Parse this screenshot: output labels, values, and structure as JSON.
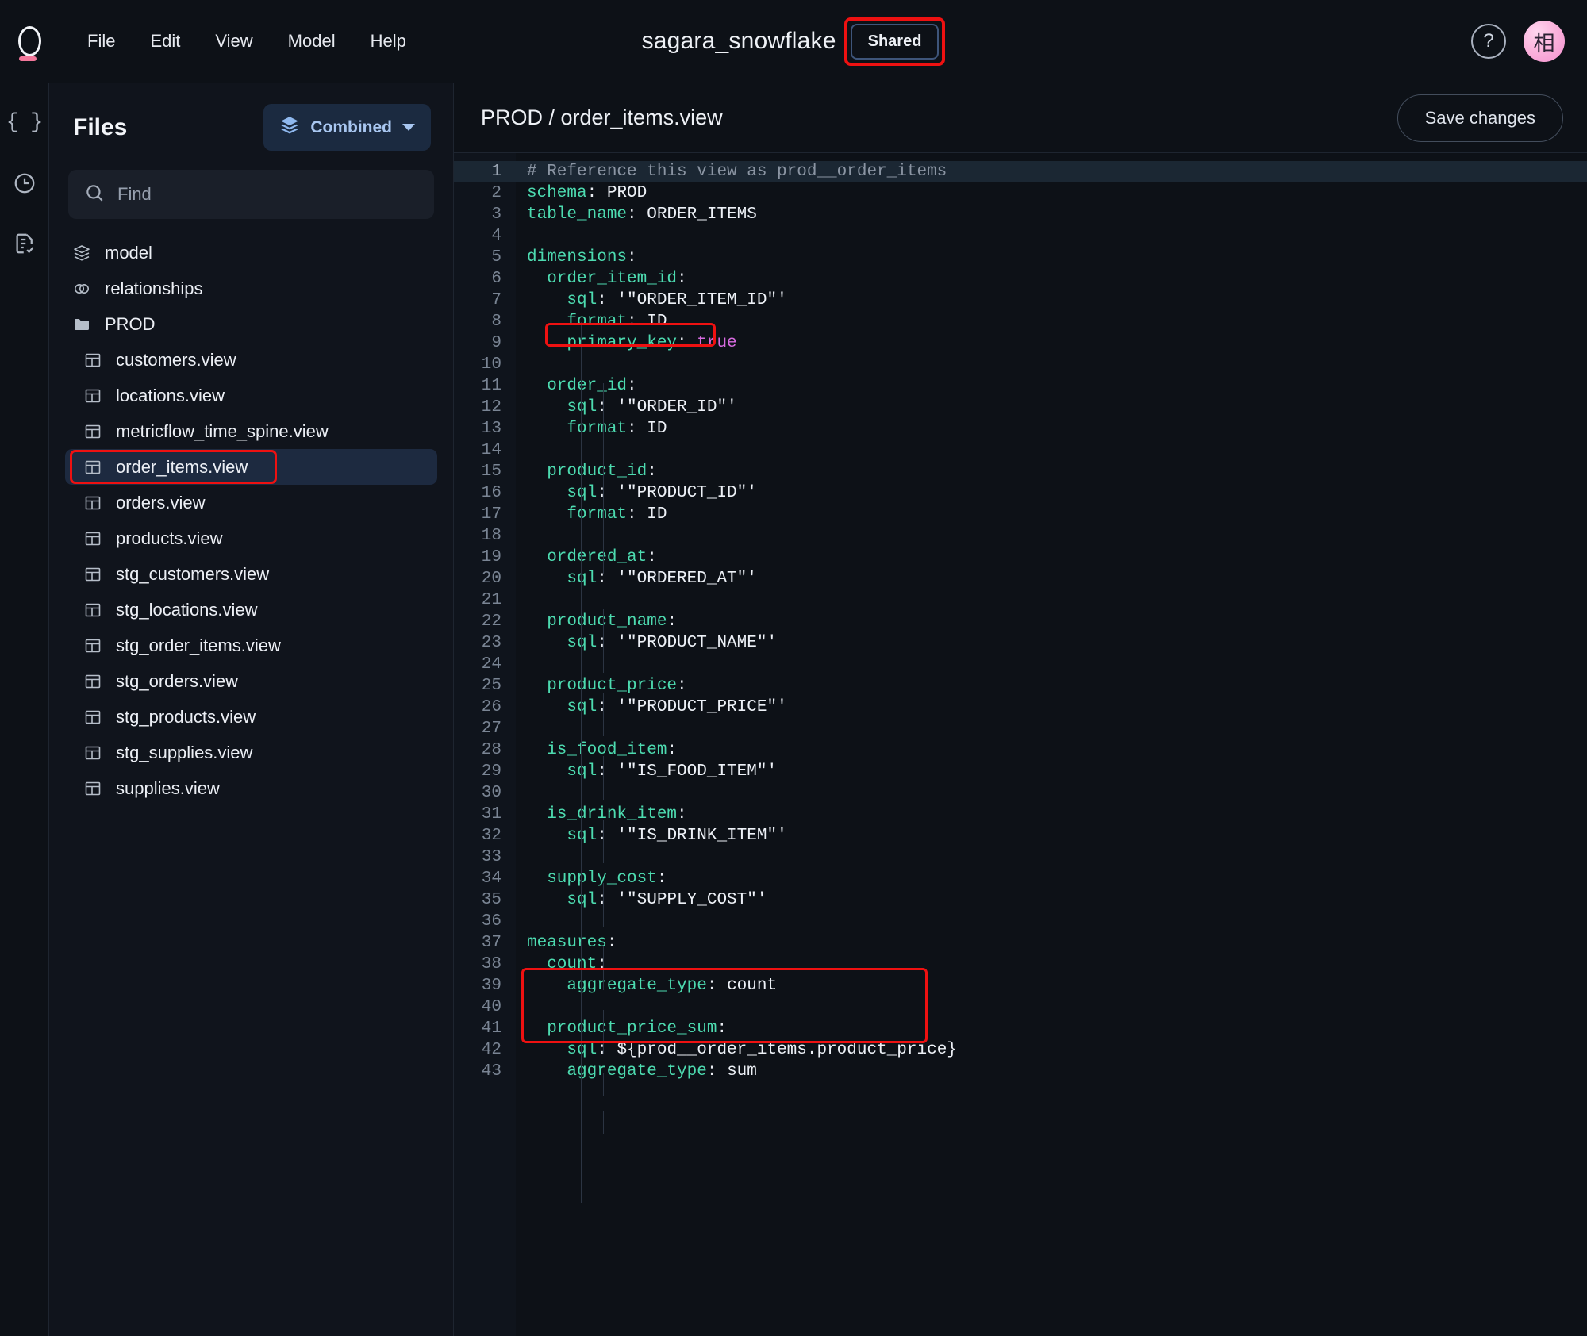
{
  "app": {
    "logo_name": "omni-logo",
    "menu": [
      "File",
      "Edit",
      "View",
      "Model",
      "Help"
    ],
    "project_title": "sagara_snowflake",
    "shared_label": "Shared",
    "help_label": "?",
    "avatar_initial": "相"
  },
  "rail": {
    "items": [
      {
        "name": "code-braces-icon",
        "glyph": "{ }"
      },
      {
        "name": "history-clock-icon",
        "glyph": "clock"
      },
      {
        "name": "document-check-icon",
        "glyph": "doc-check"
      }
    ]
  },
  "files_panel": {
    "title": "Files",
    "mode_button": {
      "label": "Combined",
      "icon": "layers-icon"
    },
    "search": {
      "placeholder": "Find",
      "value": ""
    },
    "items": [
      {
        "label": "model",
        "icon": "layers-icon",
        "indent": false,
        "selected": false
      },
      {
        "label": "relationships",
        "icon": "links-icon",
        "indent": false,
        "selected": false
      },
      {
        "label": "PROD",
        "icon": "folder-icon",
        "indent": false,
        "selected": false
      },
      {
        "label": "customers.view",
        "icon": "table-icon",
        "indent": true,
        "selected": false
      },
      {
        "label": "locations.view",
        "icon": "table-icon",
        "indent": true,
        "selected": false
      },
      {
        "label": "metricflow_time_spine.view",
        "icon": "table-icon",
        "indent": true,
        "selected": false
      },
      {
        "label": "order_items.view",
        "icon": "table-icon",
        "indent": true,
        "selected": true
      },
      {
        "label": "orders.view",
        "icon": "table-icon",
        "indent": true,
        "selected": false
      },
      {
        "label": "products.view",
        "icon": "table-icon",
        "indent": true,
        "selected": false
      },
      {
        "label": "stg_customers.view",
        "icon": "table-icon",
        "indent": true,
        "selected": false
      },
      {
        "label": "stg_locations.view",
        "icon": "table-icon",
        "indent": true,
        "selected": false
      },
      {
        "label": "stg_order_items.view",
        "icon": "table-icon",
        "indent": true,
        "selected": false
      },
      {
        "label": "stg_orders.view",
        "icon": "table-icon",
        "indent": true,
        "selected": false
      },
      {
        "label": "stg_products.view",
        "icon": "table-icon",
        "indent": true,
        "selected": false
      },
      {
        "label": "stg_supplies.view",
        "icon": "table-icon",
        "indent": true,
        "selected": false
      },
      {
        "label": "supplies.view",
        "icon": "table-icon",
        "indent": true,
        "selected": false
      }
    ]
  },
  "editor": {
    "breadcrumb": "PROD / order_items.view",
    "save_label": "Save changes",
    "first_line_highlighted": true,
    "lines": [
      {
        "n": 1,
        "tokens": [
          {
            "t": "# Reference this view as prod__order_items",
            "c": "cm"
          }
        ]
      },
      {
        "n": 2,
        "tokens": [
          {
            "t": "schema",
            "c": "k"
          },
          {
            "t": ": ",
            "c": "punc"
          },
          {
            "t": "PROD",
            "c": "v"
          }
        ]
      },
      {
        "n": 3,
        "tokens": [
          {
            "t": "table_name",
            "c": "k"
          },
          {
            "t": ": ",
            "c": "punc"
          },
          {
            "t": "ORDER_ITEMS",
            "c": "v"
          }
        ]
      },
      {
        "n": 4,
        "tokens": []
      },
      {
        "n": 5,
        "tokens": [
          {
            "t": "dimensions",
            "c": "k"
          },
          {
            "t": ":",
            "c": "punc"
          }
        ]
      },
      {
        "n": 6,
        "tokens": [
          {
            "t": "  order_item_id",
            "c": "k"
          },
          {
            "t": ":",
            "c": "punc"
          }
        ]
      },
      {
        "n": 7,
        "tokens": [
          {
            "t": "    sql",
            "c": "k"
          },
          {
            "t": ": ",
            "c": "punc"
          },
          {
            "t": "'\"ORDER_ITEM_ID\"'",
            "c": "v"
          }
        ]
      },
      {
        "n": 8,
        "tokens": [
          {
            "t": "    format",
            "c": "k"
          },
          {
            "t": ": ",
            "c": "punc"
          },
          {
            "t": "ID",
            "c": "v"
          }
        ]
      },
      {
        "n": 9,
        "tokens": [
          {
            "t": "    primary_key",
            "c": "k"
          },
          {
            "t": ": ",
            "c": "punc"
          },
          {
            "t": "true",
            "c": "bool"
          }
        ]
      },
      {
        "n": 10,
        "tokens": []
      },
      {
        "n": 11,
        "tokens": [
          {
            "t": "  order_id",
            "c": "k"
          },
          {
            "t": ":",
            "c": "punc"
          }
        ]
      },
      {
        "n": 12,
        "tokens": [
          {
            "t": "    sql",
            "c": "k"
          },
          {
            "t": ": ",
            "c": "punc"
          },
          {
            "t": "'\"ORDER_ID\"'",
            "c": "v"
          }
        ]
      },
      {
        "n": 13,
        "tokens": [
          {
            "t": "    format",
            "c": "k"
          },
          {
            "t": ": ",
            "c": "punc"
          },
          {
            "t": "ID",
            "c": "v"
          }
        ]
      },
      {
        "n": 14,
        "tokens": []
      },
      {
        "n": 15,
        "tokens": [
          {
            "t": "  product_id",
            "c": "k"
          },
          {
            "t": ":",
            "c": "punc"
          }
        ]
      },
      {
        "n": 16,
        "tokens": [
          {
            "t": "    sql",
            "c": "k"
          },
          {
            "t": ": ",
            "c": "punc"
          },
          {
            "t": "'\"PRODUCT_ID\"'",
            "c": "v"
          }
        ]
      },
      {
        "n": 17,
        "tokens": [
          {
            "t": "    format",
            "c": "k"
          },
          {
            "t": ": ",
            "c": "punc"
          },
          {
            "t": "ID",
            "c": "v"
          }
        ]
      },
      {
        "n": 18,
        "tokens": []
      },
      {
        "n": 19,
        "tokens": [
          {
            "t": "  ordered_at",
            "c": "k"
          },
          {
            "t": ":",
            "c": "punc"
          }
        ]
      },
      {
        "n": 20,
        "tokens": [
          {
            "t": "    sql",
            "c": "k"
          },
          {
            "t": ": ",
            "c": "punc"
          },
          {
            "t": "'\"ORDERED_AT\"'",
            "c": "v"
          }
        ]
      },
      {
        "n": 21,
        "tokens": []
      },
      {
        "n": 22,
        "tokens": [
          {
            "t": "  product_name",
            "c": "k"
          },
          {
            "t": ":",
            "c": "punc"
          }
        ]
      },
      {
        "n": 23,
        "tokens": [
          {
            "t": "    sql",
            "c": "k"
          },
          {
            "t": ": ",
            "c": "punc"
          },
          {
            "t": "'\"PRODUCT_NAME\"'",
            "c": "v"
          }
        ]
      },
      {
        "n": 24,
        "tokens": []
      },
      {
        "n": 25,
        "tokens": [
          {
            "t": "  product_price",
            "c": "k"
          },
          {
            "t": ":",
            "c": "punc"
          }
        ]
      },
      {
        "n": 26,
        "tokens": [
          {
            "t": "    sql",
            "c": "k"
          },
          {
            "t": ": ",
            "c": "punc"
          },
          {
            "t": "'\"PRODUCT_PRICE\"'",
            "c": "v"
          }
        ]
      },
      {
        "n": 27,
        "tokens": []
      },
      {
        "n": 28,
        "tokens": [
          {
            "t": "  is_food_item",
            "c": "k"
          },
          {
            "t": ":",
            "c": "punc"
          }
        ]
      },
      {
        "n": 29,
        "tokens": [
          {
            "t": "    sql",
            "c": "k"
          },
          {
            "t": ": ",
            "c": "punc"
          },
          {
            "t": "'\"IS_FOOD_ITEM\"'",
            "c": "v"
          }
        ]
      },
      {
        "n": 30,
        "tokens": []
      },
      {
        "n": 31,
        "tokens": [
          {
            "t": "  is_drink_item",
            "c": "k"
          },
          {
            "t": ":",
            "c": "punc"
          }
        ]
      },
      {
        "n": 32,
        "tokens": [
          {
            "t": "    sql",
            "c": "k"
          },
          {
            "t": ": ",
            "c": "punc"
          },
          {
            "t": "'\"IS_DRINK_ITEM\"'",
            "c": "v"
          }
        ]
      },
      {
        "n": 33,
        "tokens": []
      },
      {
        "n": 34,
        "tokens": [
          {
            "t": "  supply_cost",
            "c": "k"
          },
          {
            "t": ":",
            "c": "punc"
          }
        ]
      },
      {
        "n": 35,
        "tokens": [
          {
            "t": "    sql",
            "c": "k"
          },
          {
            "t": ": ",
            "c": "punc"
          },
          {
            "t": "'\"SUPPLY_COST\"'",
            "c": "v"
          }
        ]
      },
      {
        "n": 36,
        "tokens": []
      },
      {
        "n": 37,
        "tokens": [
          {
            "t": "measures",
            "c": "k"
          },
          {
            "t": ":",
            "c": "punc"
          }
        ]
      },
      {
        "n": 38,
        "tokens": [
          {
            "t": "  count",
            "c": "k"
          },
          {
            "t": ":",
            "c": "punc"
          }
        ]
      },
      {
        "n": 39,
        "tokens": [
          {
            "t": "    aggregate_type",
            "c": "k"
          },
          {
            "t": ": ",
            "c": "punc"
          },
          {
            "t": "count",
            "c": "v"
          }
        ]
      },
      {
        "n": 40,
        "tokens": []
      },
      {
        "n": 41,
        "tokens": [
          {
            "t": "  product_price_sum",
            "c": "k"
          },
          {
            "t": ":",
            "c": "punc"
          }
        ]
      },
      {
        "n": 42,
        "tokens": [
          {
            "t": "    sql",
            "c": "k"
          },
          {
            "t": ": ",
            "c": "punc"
          },
          {
            "t": "${prod__order_items.product_price}",
            "c": "v"
          }
        ]
      },
      {
        "n": 43,
        "tokens": [
          {
            "t": "    aggregate_type",
            "c": "k"
          },
          {
            "t": ": ",
            "c": "punc"
          },
          {
            "t": "sum",
            "c": "v"
          }
        ]
      }
    ]
  },
  "annotations": {
    "color": "#ee1111",
    "boxes": [
      "shared-chip",
      "order_items.view file row",
      "primary_key: true line",
      "product_price_sum block"
    ]
  }
}
